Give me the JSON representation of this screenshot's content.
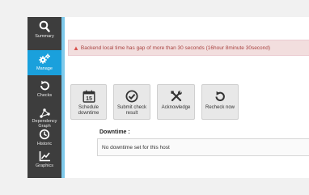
{
  "sidebar": {
    "items": [
      {
        "label": "Summary",
        "icon": "search-icon"
      },
      {
        "label": "Manage",
        "icon": "gears-icon",
        "active": true
      },
      {
        "label": "Checks",
        "icon": "refresh-icon"
      },
      {
        "label": "Dependency Graph",
        "icon": "graph-icon"
      },
      {
        "label": "Historic",
        "icon": "clock-icon"
      },
      {
        "label": "Graphics",
        "icon": "line-chart-icon"
      }
    ],
    "bg_color": "#3d3d3d",
    "active_color": "#1aa0dc"
  },
  "alert": {
    "message": "Backend local time has gap of more than 30 seconds (16hour 8minute 30second)",
    "icon": "warning-icon"
  },
  "actions": {
    "schedule_downtime": {
      "label": "Schedule downtime",
      "icon_text": "15",
      "icon": "calendar-icon"
    },
    "submit_check_result": {
      "label": "Submit check result",
      "icon": "check-circle-icon"
    },
    "acknowledge": {
      "label": "Acknowledge",
      "icon": "tools-icon"
    },
    "recheck_now": {
      "label": "Recheck now",
      "icon": "recheck-icon"
    }
  },
  "downtime": {
    "title": "Downtime :",
    "empty_message": "No downtime set for this host"
  }
}
